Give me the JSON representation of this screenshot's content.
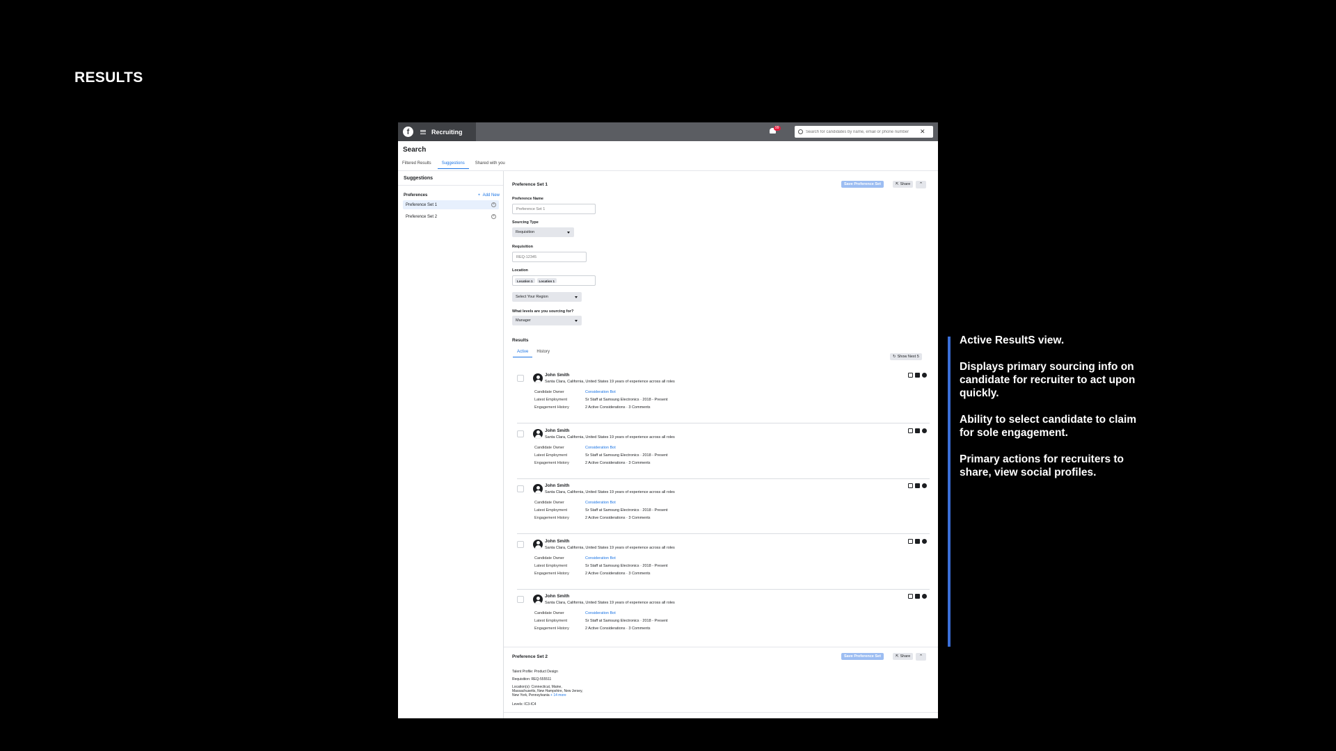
{
  "slide": {
    "title": "RESULTS",
    "annotations": [
      "Active ResultS view.",
      "Displays primary sourcing info on candidate for recruiter to act upon quickly.",
      "Ability to select candidate to claim for sole engagement.",
      "Primary actions for recruiters to share, view social profiles."
    ]
  },
  "topbar": {
    "app_name": "Recruiting",
    "notification_count": "99",
    "search_placeholder": "Search for candidates by name, email or phone number"
  },
  "page": {
    "title": "Search",
    "tabs": [
      "Filtered Results",
      "Suggestions",
      "Shared with you"
    ],
    "active_tab": "Suggestions"
  },
  "sidebar": {
    "title": "Suggestions",
    "preferences_label": "Preferences",
    "add_new": "Add New",
    "items": [
      "Preference Set 1",
      "Preference Set 2"
    ]
  },
  "pref_set_1": {
    "title": "Preference Set 1",
    "save_label": "Save Preference Set",
    "share_label": "Share",
    "name_label": "Preference Name",
    "name_placeholder": "Preference Set 1",
    "sourcing_type_label": "Sourcing Type",
    "sourcing_type_value": "Requisition",
    "requisition_label": "Requisition",
    "requisition_placeholder": "REQ-12345",
    "location_label": "Location",
    "location_chips": [
      "Location 1",
      "Location 1"
    ],
    "region_value": "Select Your Region",
    "levels_label": "What levels are you sourcing for?",
    "levels_value": "Manager"
  },
  "results": {
    "title": "Results",
    "tabs": [
      "Active",
      "History"
    ],
    "show_next": "Show Next 5",
    "field_labels": {
      "owner": "Candidate Owner",
      "employment": "Latest Employment",
      "engagement": "Engagement History"
    },
    "candidates": [
      {
        "name": "John Smith",
        "location": "Santa Clara, California, United States 19 years of experience across all roles",
        "owner": "Consideration Bot",
        "employment": "Sr Staff at Samsung Electronics · 2018 - Present",
        "engagement": "2 Active Considerations · 3 Comments"
      },
      {
        "name": "John Smith",
        "location": "Santa Clara, California, United States 19 years of experience across all roles",
        "owner": "Consideration Bot",
        "employment": "Sr Staff at Samsung Electronics · 2018 - Present",
        "engagement": "2 Active Considerations · 3 Comments"
      },
      {
        "name": "John Smith",
        "location": "Santa Clara, California, United States 19 years of experience across all roles",
        "owner": "Consideration Bot",
        "employment": "Sr Staff at Samsung Electronics · 2018 - Present",
        "engagement": "2 Active Considerations · 3 Comments"
      },
      {
        "name": "John Smith",
        "location": "Santa Clara, California, United States 19 years of experience across all roles",
        "owner": "Consideration Bot",
        "employment": "Sr Staff at Samsung Electronics · 2018 - Present",
        "engagement": "2 Active Considerations · 3 Comments"
      },
      {
        "name": "John Smith",
        "location": "Santa Clara, California, United States 19 years of experience across all roles",
        "owner": "Consideration Bot",
        "employment": "Sr Staff at Samsung Electronics · 2018 - Present",
        "engagement": "2 Active Considerations · 3 Comments"
      }
    ]
  },
  "pref_set_2": {
    "title": "Preference Set 2",
    "save_label": "Save Preference Set",
    "share_label": "Share",
    "talent_profile": "Talent Profile: Product Design",
    "requisition": "Requisition: REQ-555511",
    "locations_line1": "Location(s): Connecticut, Maine,",
    "locations_line2": "Massachusetts, New Hampshire, New Jersey,",
    "locations_line3": "New York, Pennsylvania",
    "locations_more": "+ 14 more",
    "levels": "Levels: IC3-IC4"
  },
  "colors": {
    "accent": "#1b74e4",
    "annotation_bar": "#3b6fd8",
    "topbar": "#5b5d62"
  }
}
